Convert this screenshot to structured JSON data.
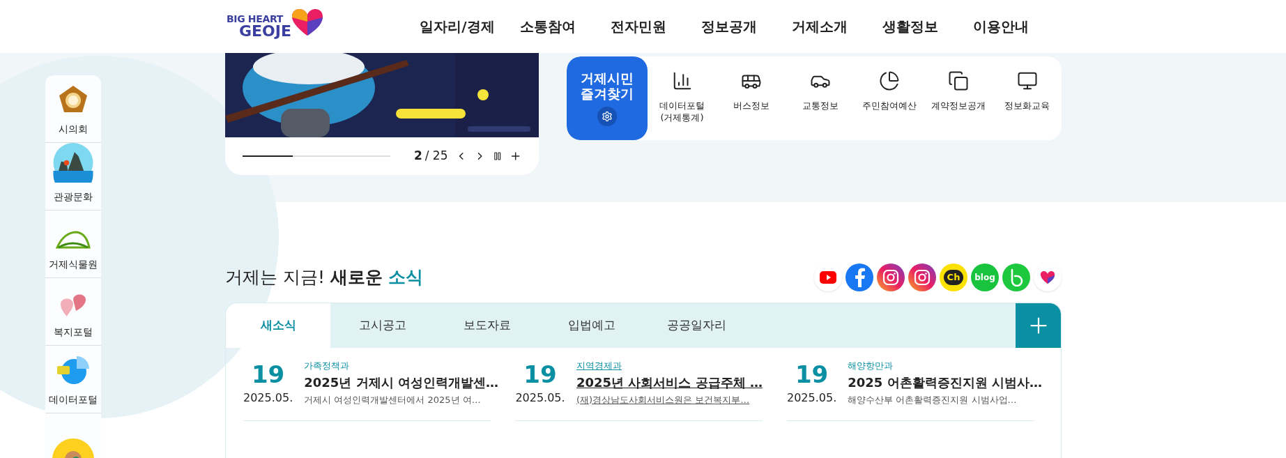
{
  "header": {
    "logo_top": "BIG HEART",
    "logo_bottom": "GEOJE",
    "nav": [
      "일자리/경제",
      "소통참여",
      "전자민원",
      "정보공개",
      "거제소개",
      "생활정보",
      "이용안내"
    ]
  },
  "sidebar": {
    "items": [
      {
        "kind": "council",
        "label": "시의회"
      },
      {
        "kind": "tour",
        "label": "관광문화"
      },
      {
        "kind": "garden",
        "label": "거제식물원"
      },
      {
        "kind": "welfare",
        "label": "복지포털"
      },
      {
        "kind": "data",
        "label": "데이터포털"
      },
      {
        "kind": "kid"
      }
    ]
  },
  "banner": {
    "progress": {
      "level": 0.34
    },
    "current": "2",
    "total": "/ 25"
  },
  "quick": {
    "title_1": "거제시민",
    "title_2": "즐겨찾기",
    "links": [
      {
        "kind": "chart",
        "label": "데이터포털\n(거제통계)"
      },
      {
        "kind": "bus",
        "label": "버스정보"
      },
      {
        "kind": "car",
        "label": "교통정보"
      },
      {
        "kind": "pie",
        "label": "주민참여예산"
      },
      {
        "kind": "docs",
        "label": "계약정보공개"
      },
      {
        "kind": "monitor",
        "label": "정보화교육"
      }
    ]
  },
  "news": {
    "title_plain": "거제는 지금!",
    "title_bold": "새로운",
    "title_accent": "소식",
    "social": [
      {
        "kind": "youtube"
      },
      {
        "kind": "facebook"
      },
      {
        "kind": "instagram"
      },
      {
        "kind": "instagram"
      },
      {
        "kind": "kakao",
        "text": "Ch"
      },
      {
        "kind": "blog",
        "text": "blog"
      },
      {
        "kind": "band"
      },
      {
        "kind": "heart"
      }
    ],
    "tabs": [
      {
        "label": "새소식",
        "selected": true
      },
      {
        "label": "고시공고",
        "selected": false
      },
      {
        "label": "보도자료",
        "selected": false
      },
      {
        "label": "입법예고",
        "selected": false
      },
      {
        "label": "공공일자리",
        "selected": false
      }
    ],
    "items": [
      {
        "day": "19",
        "month": "2025.05.",
        "dept": "가족정책과",
        "title": "2025년 거제시 여성인력개발센…",
        "desc": "거제시 여성인력개발센터에서 2025년 여…",
        "underlined": false
      },
      {
        "day": "19",
        "month": "2025.05.",
        "dept": "지역경제과",
        "title": "2025년 사회서비스 공급주체 …",
        "desc": "(재)경상남도사회서비스원은 보건복지부…",
        "underlined": true
      },
      {
        "day": "19",
        "month": "2025.05.",
        "dept": "해양항만과",
        "title": "2025 어촌활력증진지원 시범사…",
        "desc": "해양수산부 어촌활력증진지원 시범사업…",
        "underlined": false
      }
    ]
  }
}
